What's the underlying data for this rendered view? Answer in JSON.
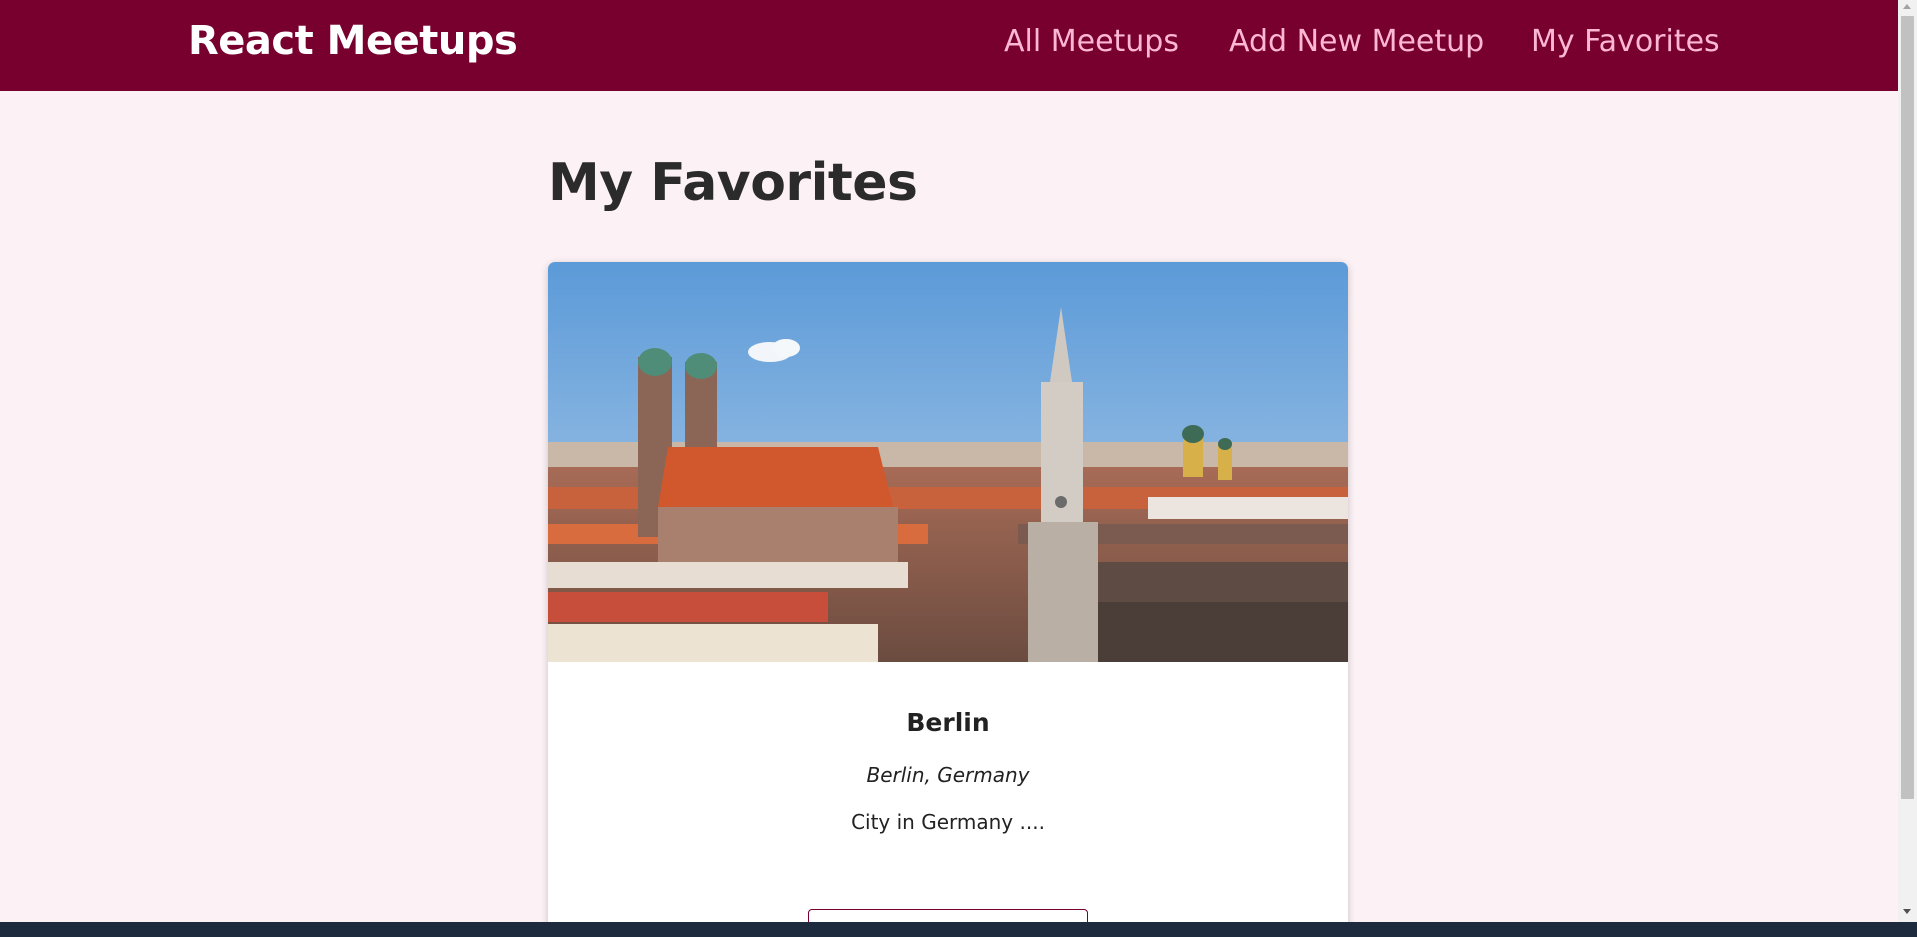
{
  "header": {
    "logo": "React Meetups",
    "nav": [
      {
        "label": "All Meetups"
      },
      {
        "label": "Add New Meetup"
      },
      {
        "label": "My Favorites"
      }
    ]
  },
  "page": {
    "title": "My Favorites"
  },
  "meetups": [
    {
      "title": "Berlin",
      "address": "Berlin, Germany",
      "description": "City in Germany ....",
      "button_label": ""
    }
  ],
  "colors": {
    "header_bg": "#77002e",
    "nav_text": "#fcb8d2",
    "page_bg": "#fcf1f5"
  },
  "icons": [
    "scroll-up-arrow-icon",
    "scroll-down-arrow-icon"
  ]
}
